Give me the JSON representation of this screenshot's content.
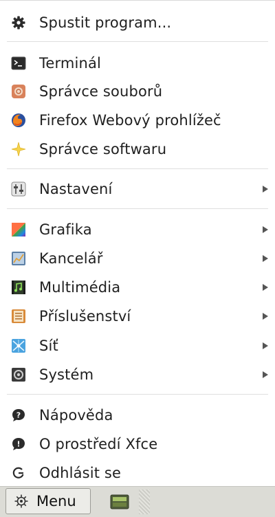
{
  "menu": {
    "run_program": "Spustit program...",
    "favorites": [
      {
        "label": "Terminál",
        "icon": "terminal-icon"
      },
      {
        "label": "Správce souborů",
        "icon": "file-manager-icon"
      },
      {
        "label": "Firefox Webový prohlížeč",
        "icon": "firefox-icon"
      },
      {
        "label": "Správce softwaru",
        "icon": "star-icon"
      }
    ],
    "settings": {
      "label": "Nastavení",
      "icon": "settings-icon"
    },
    "categories": [
      {
        "label": "Grafika",
        "icon": "graphics-icon"
      },
      {
        "label": "Kancelář",
        "icon": "office-icon"
      },
      {
        "label": "Multimédia",
        "icon": "multimedia-icon"
      },
      {
        "label": "Příslušenství",
        "icon": "accessories-icon"
      },
      {
        "label": "Síť",
        "icon": "network-icon"
      },
      {
        "label": "Systém",
        "icon": "system-icon"
      }
    ],
    "help": "Nápověda",
    "about": "O prostředí Xfce",
    "logout": "Odhlásit se"
  },
  "taskbar": {
    "menu_button_label": "Menu"
  }
}
